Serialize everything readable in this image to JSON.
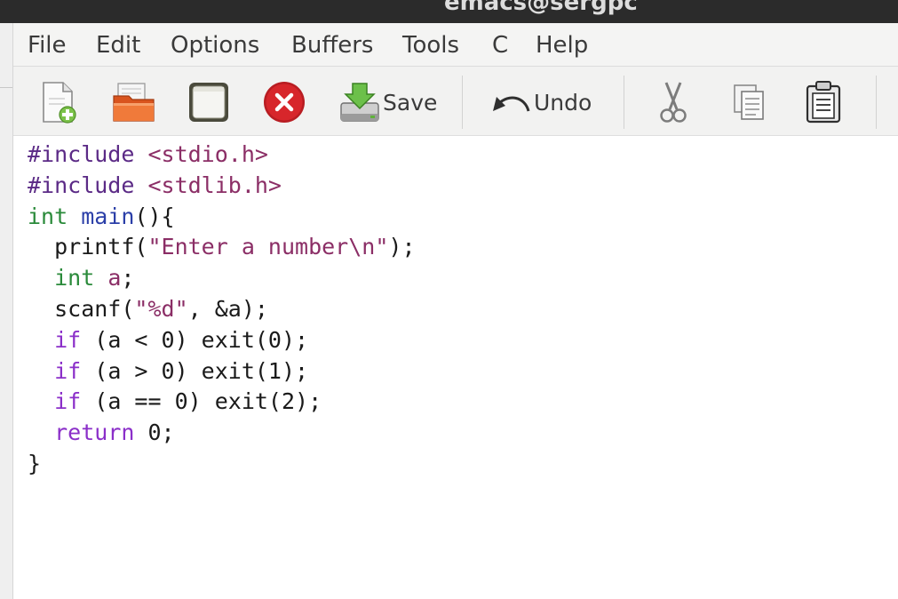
{
  "titlebar": {
    "text": "emacs@sergpc"
  },
  "menu": {
    "items": [
      {
        "label": "File"
      },
      {
        "label": "Edit"
      },
      {
        "label": "Options"
      },
      {
        "label": "Buffers"
      },
      {
        "label": "Tools"
      },
      {
        "label": "C"
      },
      {
        "label": "Help"
      }
    ]
  },
  "toolbar": {
    "new_file_icon": "new-file-icon",
    "open_folder_icon": "open-folder-icon",
    "dired_icon": "dired-frame-icon",
    "close_icon": "close-buffer-icon",
    "save_label": "Save",
    "undo_label": "Undo",
    "cut_icon": "scissors-icon",
    "copy_icon": "copy-icon",
    "paste_icon": "paste-clipboard-icon"
  },
  "editor": {
    "lines": [
      [
        {
          "t": "pp",
          "v": "#include "
        },
        {
          "t": "str",
          "v": "<stdio.h>"
        }
      ],
      [
        {
          "t": "pp",
          "v": "#include "
        },
        {
          "t": "str",
          "v": "<stdlib.h>"
        }
      ],
      [
        {
          "t": "type",
          "v": "int"
        },
        {
          "t": "plain",
          "v": " "
        },
        {
          "t": "fn",
          "v": "main"
        },
        {
          "t": "plain",
          "v": "(){"
        }
      ],
      [
        {
          "t": "plain",
          "v": "  printf("
        },
        {
          "t": "str",
          "v": "\"Enter a number\\n\""
        },
        {
          "t": "plain",
          "v": ");"
        }
      ],
      [
        {
          "t": "plain",
          "v": "  "
        },
        {
          "t": "type",
          "v": "int"
        },
        {
          "t": "plain",
          "v": " "
        },
        {
          "t": "str",
          "v": "a"
        },
        {
          "t": "plain",
          "v": ";"
        }
      ],
      [
        {
          "t": "plain",
          "v": "  scanf("
        },
        {
          "t": "str",
          "v": "\"%d\""
        },
        {
          "t": "plain",
          "v": ", &a);"
        }
      ],
      [
        {
          "t": "plain",
          "v": "  "
        },
        {
          "t": "kw",
          "v": "if"
        },
        {
          "t": "plain",
          "v": " (a < 0) exit(0);"
        }
      ],
      [
        {
          "t": "plain",
          "v": "  "
        },
        {
          "t": "kw",
          "v": "if"
        },
        {
          "t": "plain",
          "v": " (a > 0) exit(1);"
        }
      ],
      [
        {
          "t": "plain",
          "v": "  "
        },
        {
          "t": "kw",
          "v": "if"
        },
        {
          "t": "plain",
          "v": " (a == 0) exit(2);"
        }
      ],
      [
        {
          "t": "plain",
          "v": "  "
        },
        {
          "t": "kw",
          "v": "return"
        },
        {
          "t": "plain",
          "v": " 0;"
        }
      ],
      [
        {
          "t": "plain",
          "v": "}"
        }
      ]
    ]
  },
  "colors": {
    "preprocessor": "#5b2a86",
    "string": "#8b2e66",
    "type": "#2a8a3a",
    "keyword": "#8b2fc9",
    "function": "#2b3fa8",
    "close_button": "#d7262b"
  }
}
